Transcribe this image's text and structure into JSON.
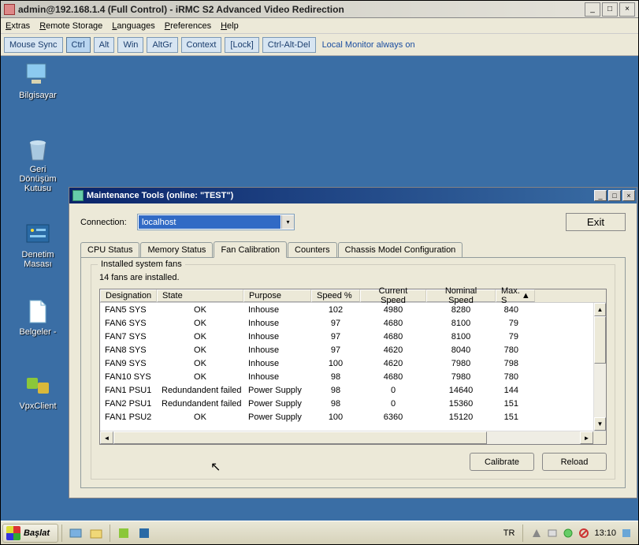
{
  "outer_title": "admin@192.168.1.4 (Full Control) - iRMC S2 Advanced Video Redirection",
  "menubar": [
    "Extras",
    "Remote Storage",
    "Languages",
    "Preferences",
    "Help"
  ],
  "toolbar": {
    "mouse_sync": "Mouse Sync",
    "ctrl": "Ctrl",
    "alt": "Alt",
    "win": "Win",
    "altgr": "AltGr",
    "context": "Context",
    "lock": "[Lock]",
    "cad": "Ctrl-Alt-Del",
    "monitor_text": "Local Monitor always on"
  },
  "desktop_icons": {
    "bilgisayar": "Bilgisayar",
    "geri": "Geri Dönüşüm Kutusu",
    "denetim": "Denetim Masası",
    "belgeler": "Belgeler -",
    "vpx": "VpxClient"
  },
  "dialog": {
    "title": "Maintenance Tools  (online: \"TEST\")",
    "connection_label": "Connection:",
    "connection_value": "localhost",
    "exit": "Exit",
    "tabs": {
      "cpu": "CPU Status",
      "mem": "Memory Status",
      "fan": "Fan Calibration",
      "counters": "Counters",
      "chassis": "Chassis Model Configuration"
    },
    "legend": "Installed system fans",
    "fan_count": "14 fans are installed.",
    "columns": [
      "Designation",
      "State",
      "Purpose",
      "Speed %",
      "Current Speed",
      "Nominal Speed",
      "Max. S"
    ],
    "rows": [
      {
        "d": "FAN5 SYS",
        "s": "OK",
        "p": "Inhouse",
        "sp": "102",
        "cs": "4980",
        "ns": "8280",
        "mx": "840"
      },
      {
        "d": "FAN6 SYS",
        "s": "OK",
        "p": "Inhouse",
        "sp": "97",
        "cs": "4680",
        "ns": "8100",
        "mx": "79"
      },
      {
        "d": "FAN7 SYS",
        "s": "OK",
        "p": "Inhouse",
        "sp": "97",
        "cs": "4680",
        "ns": "8100",
        "mx": "79"
      },
      {
        "d": "FAN8 SYS",
        "s": "OK",
        "p": "Inhouse",
        "sp": "97",
        "cs": "4620",
        "ns": "8040",
        "mx": "780"
      },
      {
        "d": "FAN9 SYS",
        "s": "OK",
        "p": "Inhouse",
        "sp": "100",
        "cs": "4620",
        "ns": "7980",
        "mx": "798"
      },
      {
        "d": "FAN10 SYS",
        "s": "OK",
        "p": "Inhouse",
        "sp": "98",
        "cs": "4680",
        "ns": "7980",
        "mx": "780"
      },
      {
        "d": "FAN1 PSU1",
        "s": "Redundandent failed",
        "p": "Power Supply",
        "sp": "98",
        "cs": "0",
        "ns": "14640",
        "mx": "144"
      },
      {
        "d": "FAN2 PSU1",
        "s": "Redundandent failed",
        "p": "Power Supply",
        "sp": "98",
        "cs": "0",
        "ns": "15360",
        "mx": "151"
      },
      {
        "d": "FAN1 PSU2",
        "s": "OK",
        "p": "Power Supply",
        "sp": "100",
        "cs": "6360",
        "ns": "15120",
        "mx": "151"
      }
    ],
    "calibrate": "Calibrate",
    "reload": "Reload"
  },
  "taskbar": {
    "start": "Başlat",
    "lang": "TR",
    "time": "13:10"
  }
}
